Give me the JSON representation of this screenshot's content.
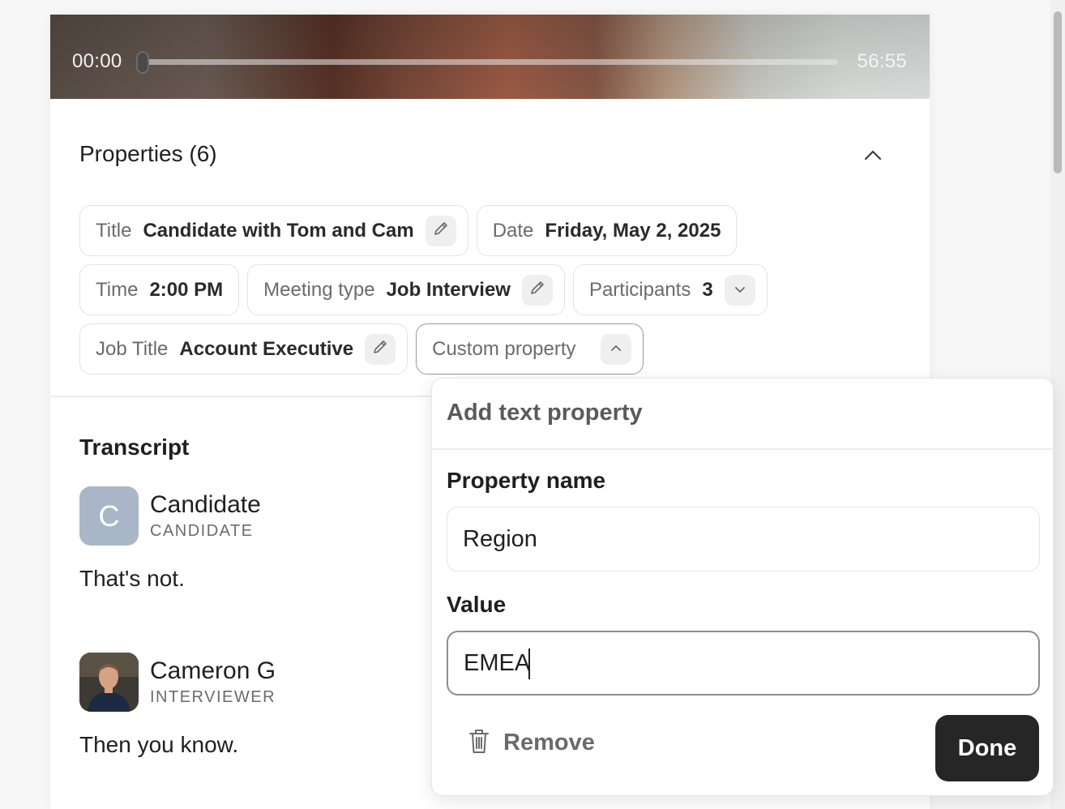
{
  "player": {
    "current_time": "00:00",
    "duration": "56:55",
    "progress": 0
  },
  "properties": {
    "title": "Properties (6)",
    "chips": [
      {
        "label": "Title",
        "value": "Candidate with Tom and Cam",
        "icon": "pencil-icon"
      },
      {
        "label": "Date",
        "value": "Friday, May 2, 2025"
      },
      {
        "label": "Time",
        "value": "2:00 PM"
      },
      {
        "label": "Meeting type",
        "value": "Job Interview",
        "icon": "pencil-icon"
      },
      {
        "label": "Participants",
        "value": "3",
        "icon": "chevron-down-icon"
      },
      {
        "label": "Job Title",
        "value": "Account Executive",
        "icon": "pencil-icon"
      },
      {
        "label": "Custom property",
        "icon": "chevron-up-icon"
      }
    ]
  },
  "transcript": {
    "title": "Transcript",
    "entries": [
      {
        "avatar_letter": "C",
        "name": "Candidate",
        "role": "CANDIDATE",
        "text": "That's not."
      },
      {
        "name": "Cameron G",
        "role": "INTERVIEWER",
        "text": "Then you know."
      }
    ]
  },
  "popover": {
    "heading": "Add text property",
    "name_label": "Property name",
    "name_value": "Region",
    "value_label": "Value",
    "value_value": "EMEA",
    "remove_label": "Remove",
    "done_label": "Done"
  }
}
